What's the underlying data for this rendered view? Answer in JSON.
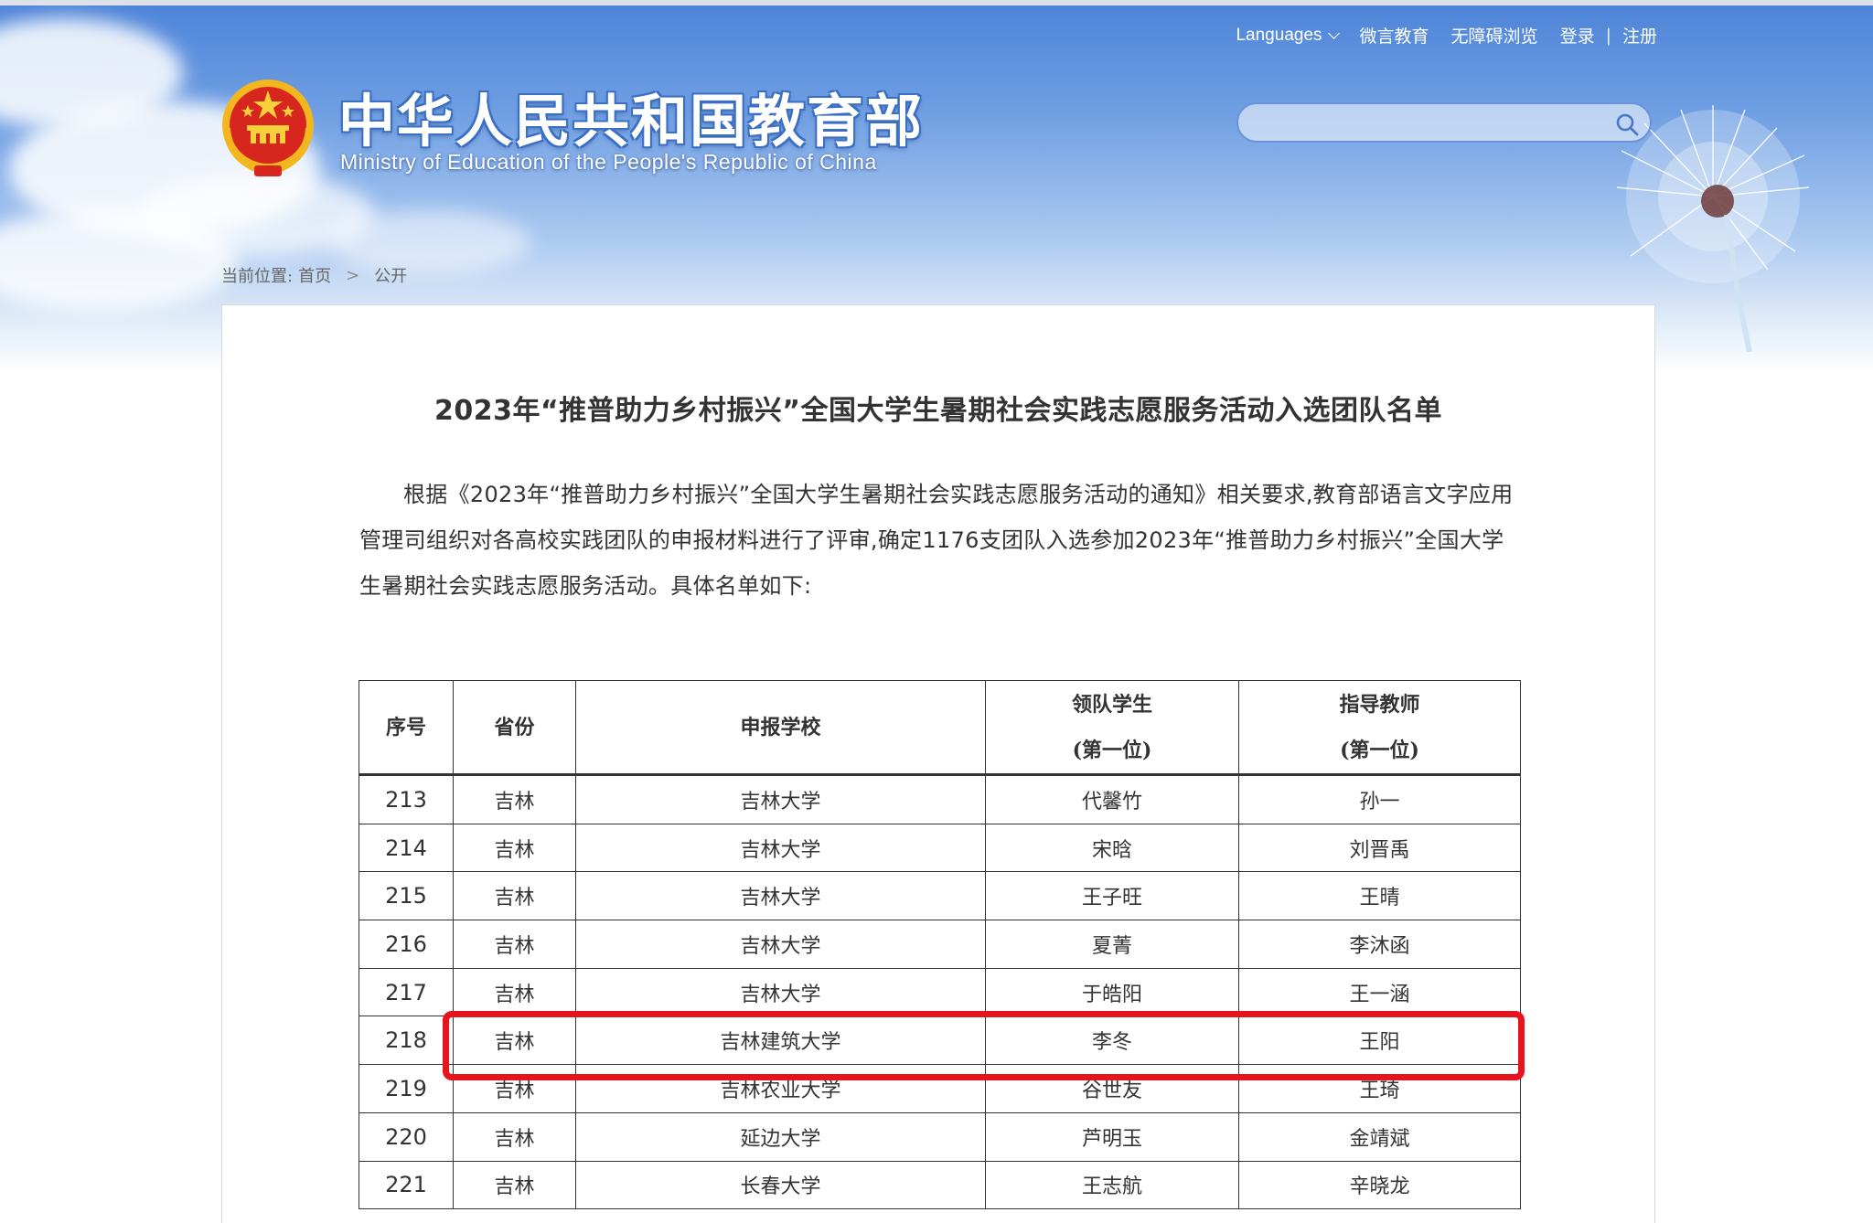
{
  "header": {
    "site_title": "中华人民共和国教育部",
    "site_subtitle": "Ministry of Education of the People's Republic of China",
    "nav": {
      "languages": "Languages",
      "weiyan": "微言教育",
      "accessible": "无障碍浏览",
      "login": "登录",
      "separator": "|",
      "register": "注册"
    },
    "search": {
      "value": "",
      "placeholder": ""
    }
  },
  "breadcrumb": {
    "label": "当前位置:",
    "home": "首页",
    "separator": ">",
    "current": "公开"
  },
  "article": {
    "title": "2023年“推普助力乡村振兴”全国大学生暑期社会实践志愿服务活动入选团队名单",
    "body": "根据《2023年“推普助力乡村振兴”全国大学生暑期社会实践志愿服务活动的通知》相关要求,教育部语言文字应用管理司组织对各高校实践团队的申报材料进行了评审,确定1176支团队入选参加2023年“推普助力乡村振兴”全国大学生暑期社会实践志愿服务活动。具体名单如下:"
  },
  "table": {
    "headers": {
      "no": "序号",
      "province": "省份",
      "school": "申报学校",
      "leader": "领队学生",
      "leader_sub": "(第一位)",
      "teacher": "指导教师",
      "teacher_sub": "(第一位)"
    },
    "rows": [
      {
        "no": "213",
        "province": "吉林",
        "school": "吉林大学",
        "leader": "代馨竹",
        "teacher": "孙一"
      },
      {
        "no": "214",
        "province": "吉林",
        "school": "吉林大学",
        "leader": "宋晗",
        "teacher": "刘晋禹"
      },
      {
        "no": "215",
        "province": "吉林",
        "school": "吉林大学",
        "leader": "王子旺",
        "teacher": "王晴"
      },
      {
        "no": "216",
        "province": "吉林",
        "school": "吉林大学",
        "leader": "夏菁",
        "teacher": "李沐函"
      },
      {
        "no": "217",
        "province": "吉林",
        "school": "吉林大学",
        "leader": "于皓阳",
        "teacher": "王一涵"
      },
      {
        "no": "218",
        "province": "吉林",
        "school": "吉林建筑大学",
        "leader": "李冬",
        "teacher": "王阳"
      },
      {
        "no": "219",
        "province": "吉林",
        "school": "吉林农业大学",
        "leader": "谷世友",
        "teacher": "王琦"
      },
      {
        "no": "220",
        "province": "吉林",
        "school": "延边大学",
        "leader": "芦明玉",
        "teacher": "金靖斌"
      },
      {
        "no": "221",
        "province": "吉林",
        "school": "长春大学",
        "leader": "王志航",
        "teacher": "辛晓龙"
      }
    ],
    "highlighted_row": "218",
    "highlight_color": "#e8141c"
  },
  "colors": {
    "header_blue": "#4d83d8",
    "text": "#333333"
  }
}
